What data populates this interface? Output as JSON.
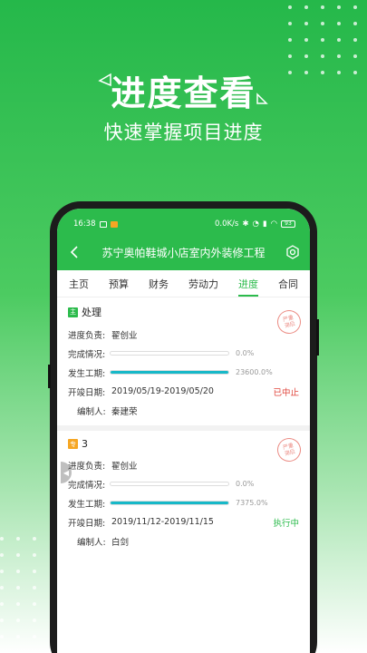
{
  "promo": {
    "title": "进度查看",
    "subtitle": "快速掌握项目进度"
  },
  "statusbar": {
    "time": "16:38",
    "network": "0.0K/s",
    "battery": "93"
  },
  "navbar": {
    "title": "苏宁奥帕鞋城小店室内外装修工程",
    "back_icon": "chevron-left-icon",
    "settings_icon": "gear-icon"
  },
  "tabs": [
    {
      "label": "主页"
    },
    {
      "label": "预算"
    },
    {
      "label": "财务"
    },
    {
      "label": "劳动力"
    },
    {
      "label": "进度",
      "active": true
    },
    {
      "label": "合同"
    }
  ],
  "colors": {
    "brand": "#2cbb4c",
    "progress": "#17b8c8",
    "stopped": "#e0463c"
  },
  "cards": [
    {
      "tag": "主",
      "title": "处理",
      "owner_label": "进度负责:",
      "owner": "翟创业",
      "completion_label": "完成情况:",
      "completion_pct": "0.0%",
      "completion_fraction": 0,
      "period_label": "发生工期:",
      "period_pct": "23600.0%",
      "period_fraction": 1,
      "dates_label": "开竣日期:",
      "dates": "2019/05/19-2019/05/20",
      "status": "已中止",
      "editor_label": "编制人:",
      "editor": "秦建荣",
      "stamp": "严重\n滞后"
    },
    {
      "tag": "专",
      "title": "3",
      "owner_label": "进度负责:",
      "owner": "翟创业",
      "completion_label": "完成情况:",
      "completion_pct": "0.0%",
      "completion_fraction": 0,
      "period_label": "发生工期:",
      "period_pct": "7375.0%",
      "period_fraction": 1,
      "dates_label": "开竣日期:",
      "dates": "2019/11/12-2019/11/15",
      "status": "执行中",
      "editor_label": "编制人:",
      "editor": "白剑",
      "stamp": "严重\n滞后"
    }
  ]
}
